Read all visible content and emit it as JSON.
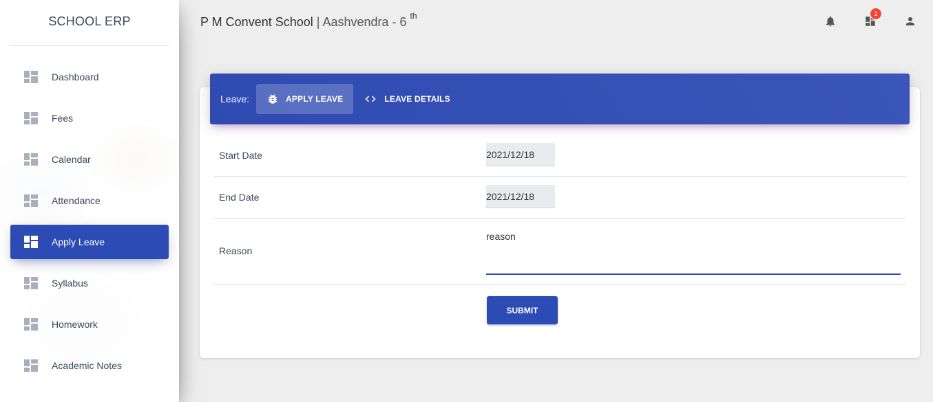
{
  "sidebar": {
    "brand": "SCHOOL ERP",
    "items": [
      {
        "label": "Dashboard",
        "icon": "dashboard-icon",
        "active": false
      },
      {
        "label": "Fees",
        "icon": "dashboard-icon",
        "active": false
      },
      {
        "label": "Calendar",
        "icon": "dashboard-icon",
        "active": false
      },
      {
        "label": "Attendance",
        "icon": "dashboard-icon",
        "active": false
      },
      {
        "label": "Apply Leave",
        "icon": "dashboard-icon",
        "active": true
      },
      {
        "label": "Syllabus",
        "icon": "dashboard-icon",
        "active": false
      },
      {
        "label": "Homework",
        "icon": "dashboard-icon",
        "active": false
      },
      {
        "label": "Academic Notes",
        "icon": "dashboard-icon",
        "active": false
      }
    ]
  },
  "header": {
    "school_name": "P M Convent School",
    "separator": " | ",
    "student": "Aashvendra - 6 ",
    "grade_suffix": "th",
    "notification_icon": "bell-icon",
    "apps_icon": "dashboard-icon",
    "apps_badge": "1",
    "user_icon": "person-icon"
  },
  "leave": {
    "tabs_title": "Leave:",
    "tabs": [
      {
        "label": "APPLY LEAVE",
        "icon": "bug-icon",
        "active": true
      },
      {
        "label": "LEAVE DETAILS",
        "icon": "code-icon",
        "active": false
      }
    ],
    "form": {
      "start_date_label": "Start Date",
      "start_date_value": "2021/12/18",
      "end_date_label": "End Date",
      "end_date_value": "2021/12/18",
      "reason_label": "Reason",
      "reason_value": "reason",
      "submit_label": "SUBMIT"
    }
  },
  "colors": {
    "primary": "#2d4bb4",
    "badge": "#f44336",
    "background": "#eeeeee"
  }
}
